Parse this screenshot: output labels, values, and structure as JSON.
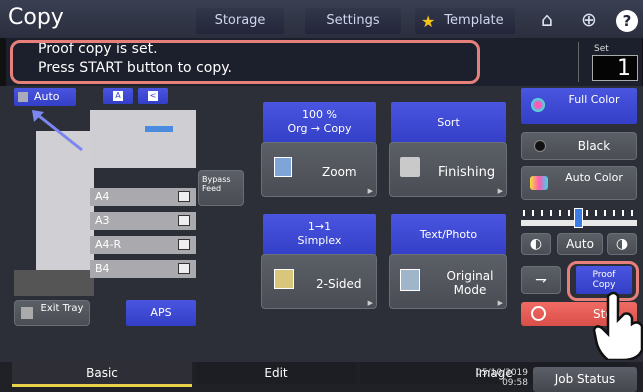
{
  "header": {
    "title": "Copy",
    "tabs": [
      {
        "label": "Storage"
      },
      {
        "label": "Settings"
      },
      {
        "label": "Template"
      }
    ],
    "icons": [
      "home-star-icon",
      "globe-icon",
      "help-icon"
    ]
  },
  "message": {
    "line1": "Proof copy is set.",
    "line2": "Press START button to copy."
  },
  "set": {
    "label": "Set",
    "value": "1"
  },
  "paper": {
    "auto_label": "Auto",
    "trays": [
      "A4",
      "A3",
      "A4-R",
      "B4"
    ],
    "bypass_label": "Bypass Feed",
    "exit_tray_label": "Exit Tray",
    "aps_label": "APS"
  },
  "functions": {
    "ratio_top": "100 %",
    "ratio_bottom": "Org  →  Copy",
    "zoom": "Zoom",
    "sort": "Sort",
    "finishing": "Finishing",
    "duplex_top": "1→1",
    "duplex_bottom": "Simplex",
    "two_sided": "2-Sided",
    "textphoto": "Text/Photo",
    "original_mode": "Original Mode"
  },
  "color": {
    "full_color": "Full Color",
    "black": "Black",
    "auto_color": "Auto Color",
    "density_auto": "Auto",
    "proof_copy": "Proof Copy",
    "stop": "Stop"
  },
  "bottom": {
    "tabs": [
      "Basic",
      "Edit",
      "Image"
    ],
    "date": "05/10/2019",
    "time": "09:58",
    "job_status": "Job Status"
  },
  "colors": {
    "accent_blue": "#3b47d6",
    "highlight": "#e5807a",
    "stop_red": "#e05a5a",
    "basic_underline": "#e8d24a"
  }
}
